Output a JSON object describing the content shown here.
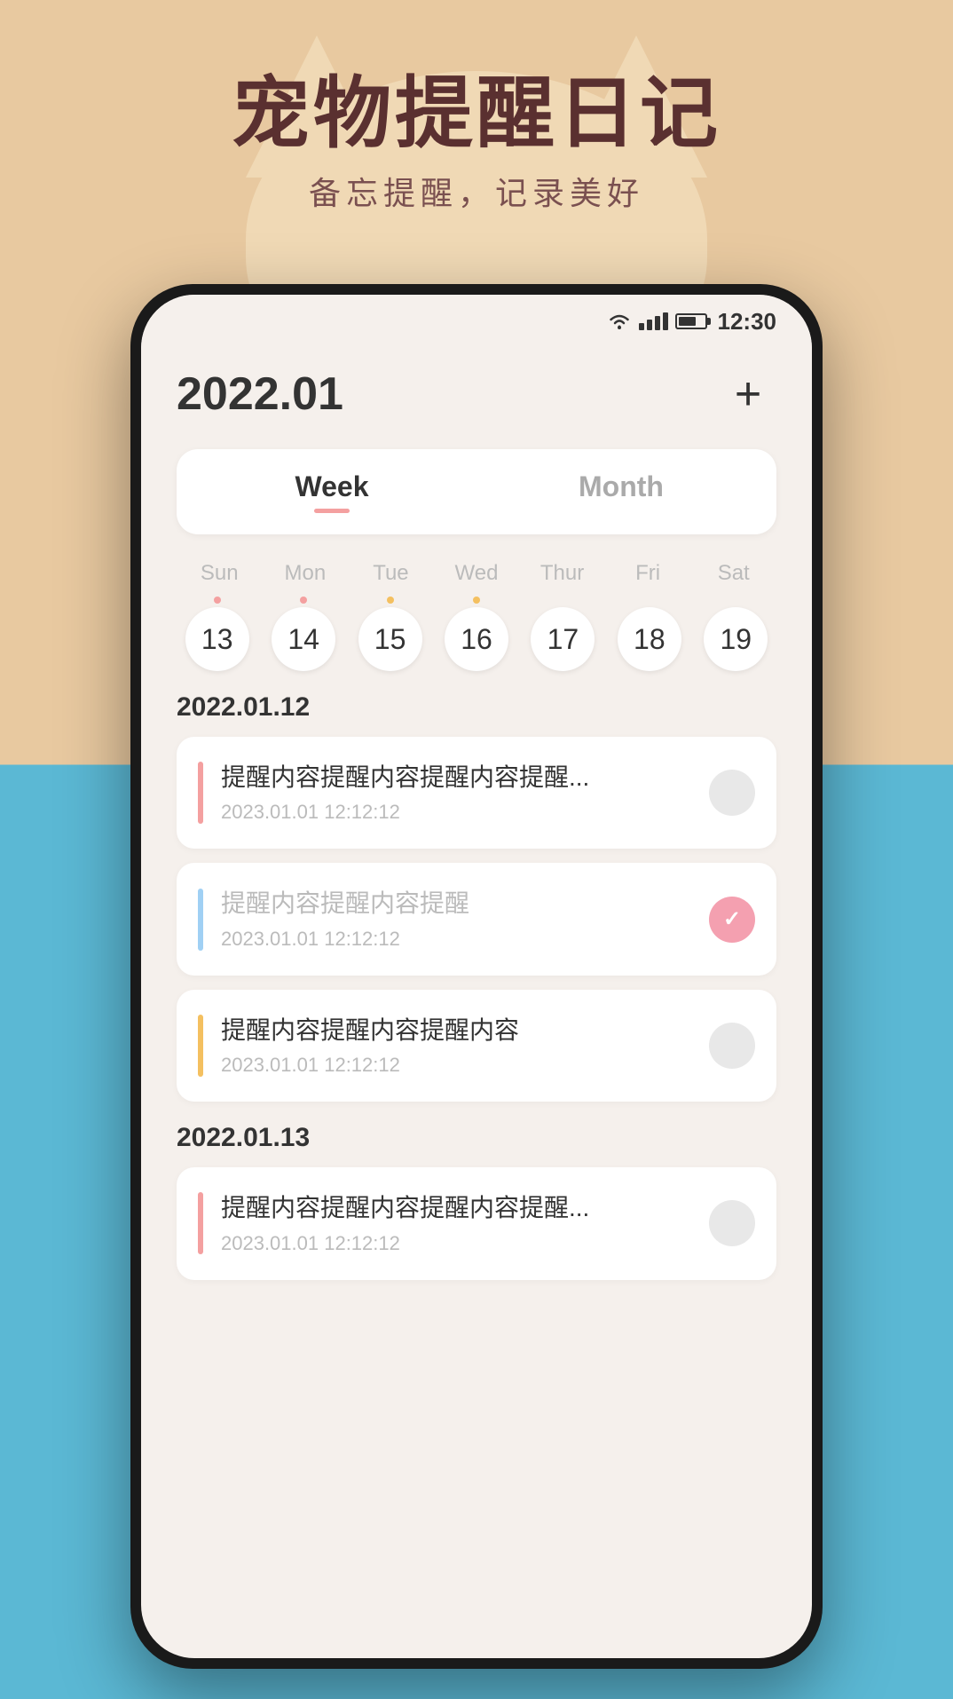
{
  "background": {
    "top_color": "#e8c9a0",
    "bottom_color": "#5bb8d4"
  },
  "header_banner": {
    "main_title": "宠物提醒日记",
    "subtitle": "备忘提醒，记录美好"
  },
  "status_bar": {
    "time": "12:30"
  },
  "app": {
    "header": {
      "date_label": "2022.01",
      "add_button_label": "+"
    },
    "tabs": [
      {
        "id": "week",
        "label": "Week",
        "active": true
      },
      {
        "id": "month",
        "label": "Month",
        "active": false
      }
    ],
    "calendar": {
      "weekdays": [
        "Sun",
        "Mon",
        "Tue",
        "Wed",
        "Thur",
        "Fri",
        "Sat"
      ],
      "days": [
        {
          "num": "13",
          "dot_color": "#f4a0a0",
          "has_dot": true
        },
        {
          "num": "14",
          "dot_color": "#f4a0a0",
          "has_dot": true
        },
        {
          "num": "15",
          "dot_color": "#f4c060",
          "has_dot": true
        },
        {
          "num": "16",
          "dot_color": "#f4c060",
          "has_dot": true
        },
        {
          "num": "17",
          "dot_color": "",
          "has_dot": false
        },
        {
          "num": "18",
          "dot_color": "",
          "has_dot": false
        },
        {
          "num": "19",
          "dot_color": "",
          "has_dot": false
        }
      ]
    },
    "reminder_groups": [
      {
        "date_label": "2022.01.12",
        "reminders": [
          {
            "accent_color": "#f4a0a0",
            "title": "提醒内容提醒内容提醒内容提醒...",
            "time": "2023.01.01  12:12:12",
            "completed": false,
            "title_muted": false
          },
          {
            "accent_color": "#a0d0f4",
            "title": "提醒内容提醒内容提醒",
            "time": "2023.01.01  12:12:12",
            "completed": true,
            "title_muted": true
          },
          {
            "accent_color": "#f4c060",
            "title": "提醒内容提醒内容提醒内容",
            "time": "2023.01.01  12:12:12",
            "completed": false,
            "title_muted": false
          }
        ]
      },
      {
        "date_label": "2022.01.13",
        "reminders": [
          {
            "accent_color": "#f4a0a0",
            "title": "提醒内容提醒内容提醒内容提醒...",
            "time": "2023.01.01  12:12:12",
            "completed": false,
            "title_muted": false
          }
        ]
      }
    ]
  }
}
